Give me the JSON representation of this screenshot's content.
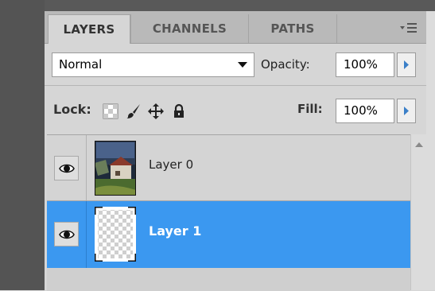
{
  "tabs": [
    {
      "label": "LAYERS",
      "active": true
    },
    {
      "label": "CHANNELS",
      "active": false
    },
    {
      "label": "PATHS",
      "active": false
    }
  ],
  "blend_mode": {
    "selected": "Normal"
  },
  "opacity": {
    "label": "Opacity:",
    "value": "100%"
  },
  "lock": {
    "label": "Lock:",
    "icons": [
      "lock-transparent-pixels-icon",
      "lock-image-pixels-icon",
      "lock-position-icon",
      "lock-all-icon"
    ]
  },
  "fill": {
    "label": "Fill:",
    "value": "100%"
  },
  "layers": [
    {
      "name": "Layer 0",
      "visible": true,
      "selected": false,
      "thumbnail": "photo"
    },
    {
      "name": "Layer 1",
      "visible": true,
      "selected": true,
      "thumbnail": "transparent"
    }
  ],
  "colors": {
    "selected_row": "#3b98f0",
    "panel_bg": "#d6d6d6",
    "frame_dark": "#545454"
  }
}
